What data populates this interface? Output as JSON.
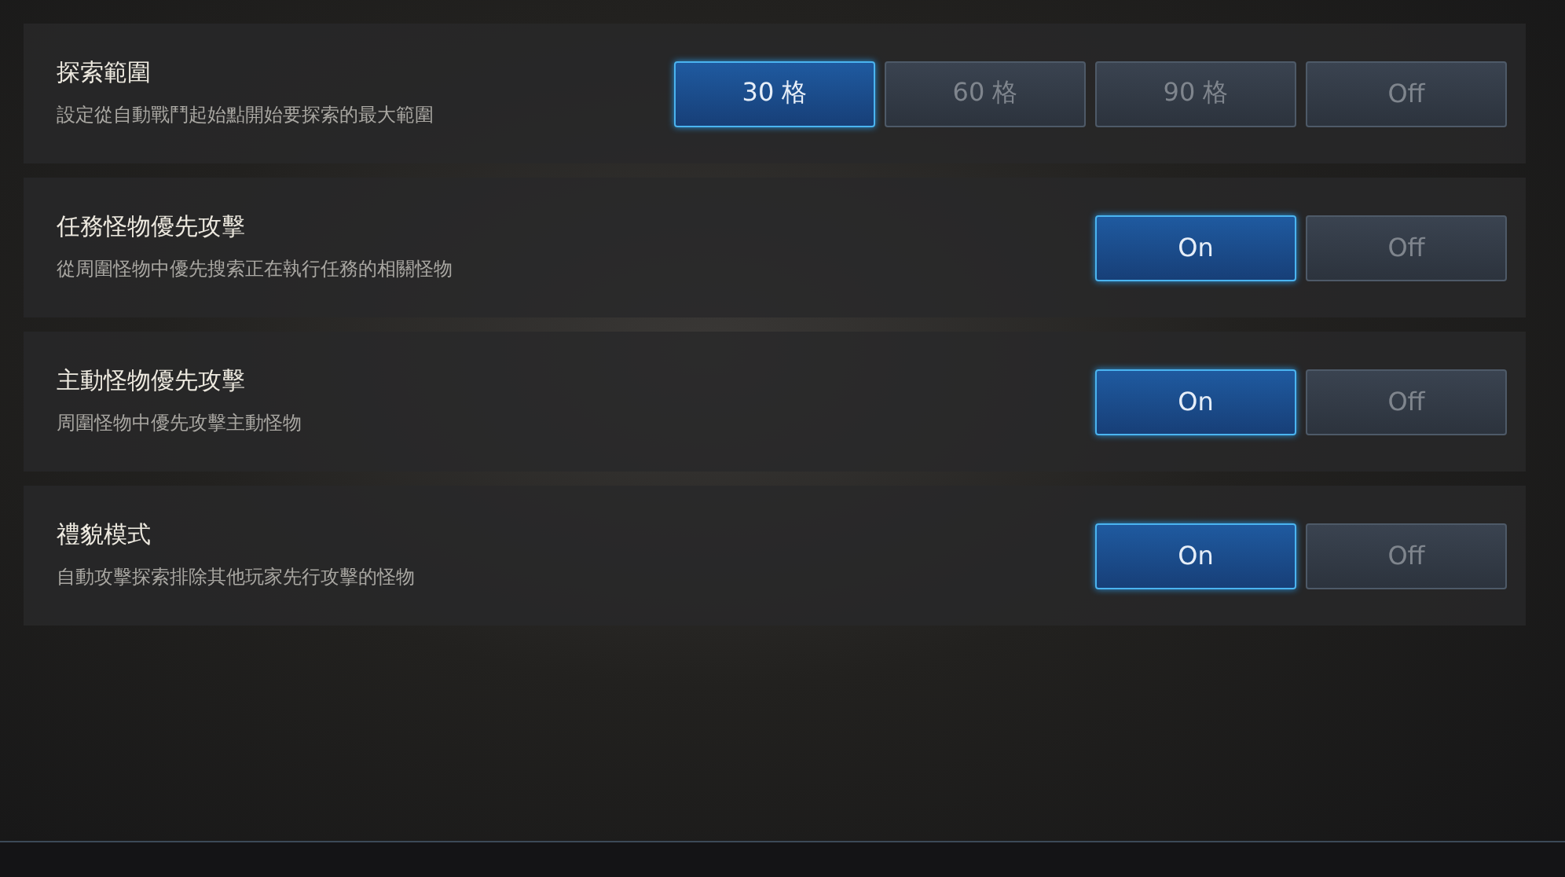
{
  "settings": [
    {
      "title": "探索範圍",
      "description": "設定從自動戰鬥起始點開始要探索的最大範圍",
      "options": [
        {
          "label": "30 格",
          "selected": true
        },
        {
          "label": "60 格",
          "selected": false
        },
        {
          "label": "90 格",
          "selected": false
        },
        {
          "label": "Off",
          "selected": false
        }
      ]
    },
    {
      "title": "任務怪物優先攻擊",
      "description": "從周圍怪物中優先搜索正在執行任務的相關怪物",
      "options": [
        {
          "label": "On",
          "selected": true
        },
        {
          "label": "Off",
          "selected": false
        }
      ]
    },
    {
      "title": "主動怪物優先攻擊",
      "description": "周圍怪物中優先攻擊主動怪物",
      "options": [
        {
          "label": "On",
          "selected": true
        },
        {
          "label": "Off",
          "selected": false
        }
      ]
    },
    {
      "title": "禮貌模式",
      "description": "自動攻擊探索排除其他玩家先行攻擊的怪物",
      "options": [
        {
          "label": "On",
          "selected": true
        },
        {
          "label": "Off",
          "selected": false
        }
      ]
    }
  ]
}
